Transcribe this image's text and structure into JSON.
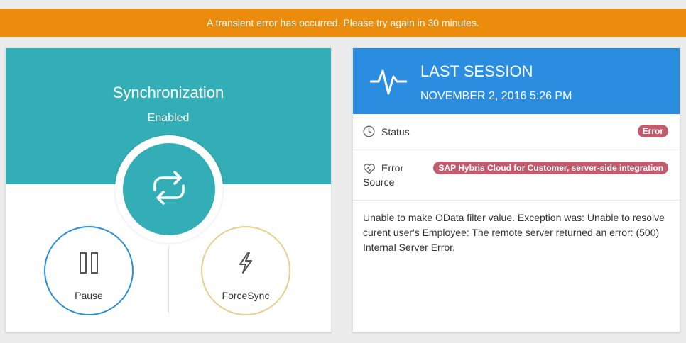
{
  "banner": {
    "message": "A transient error has occurred. Please try again in 30 minutes.",
    "color": "#ec8c0d"
  },
  "sync": {
    "title": "Synchronization",
    "status": "Enabled",
    "accent": "#34aeb6",
    "icon": "sync-icon",
    "actions": [
      {
        "label": "Pause",
        "icon": "pause-icon",
        "border_color": "#2b8fd6"
      },
      {
        "label": "ForceSync",
        "icon": "lightning-icon",
        "border_color": "#e8cf8e"
      }
    ]
  },
  "session": {
    "title": "LAST SESSION",
    "date": "NOVEMBER 2, 2016 5:26 PM",
    "header_color": "#2a8ddf",
    "icon": "pulse-icon",
    "status_label": "Status",
    "status_icon": "clock-icon",
    "status_badge": "Error",
    "source_label_1": "Error",
    "source_label_2": "Source",
    "source_icon": "heart-pulse-icon",
    "source_badge": "SAP Hybris Cloud for Customer, server-side integration",
    "badge_color": "#c25b6e",
    "message": "Unable to make OData filter value. Exception was: Unable to resolve curent user's Employee: The remote server returned an error: (500) Internal Server Error."
  }
}
